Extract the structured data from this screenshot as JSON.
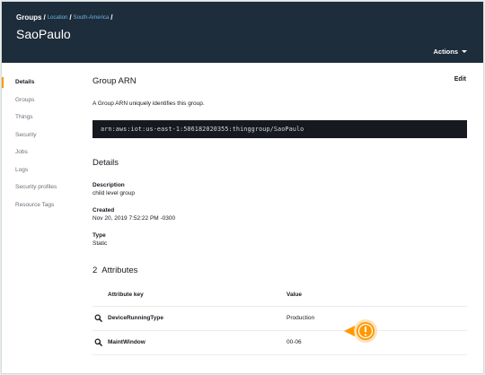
{
  "breadcrumb": {
    "root": "Groups",
    "sep": "/",
    "items": [
      "Location",
      "South-America"
    ]
  },
  "header": {
    "title": "SaoPaulo",
    "actions_label": "Actions"
  },
  "sidebar": {
    "items": [
      {
        "label": "Details",
        "active": true
      },
      {
        "label": "Groups"
      },
      {
        "label": "Things"
      },
      {
        "label": "Security"
      },
      {
        "label": "Jobs"
      },
      {
        "label": "Logs"
      },
      {
        "label": "Security profiles"
      },
      {
        "label": "Resource Tags"
      }
    ]
  },
  "arn": {
    "title": "Group ARN",
    "edit_label": "Edit",
    "description": "A Group ARN uniquely identifies this group.",
    "value": "arn:aws:iot:us-east-1:506182020355:thinggroup/SaoPaulo"
  },
  "details": {
    "title": "Details",
    "fields": [
      {
        "label": "Description",
        "value": "child level group"
      },
      {
        "label": "Created",
        "value": "Nov 20, 2019 7:52:22 PM -0300"
      },
      {
        "label": "Type",
        "value": "Static"
      }
    ]
  },
  "attributes": {
    "count": "2",
    "title": "Attributes",
    "columns": [
      "Attribute key",
      "Value"
    ],
    "rows": [
      {
        "key": "DeviceRunningType",
        "value": "Production"
      },
      {
        "key": "MaintWindow",
        "value": "00-06"
      }
    ]
  },
  "colors": {
    "header_bg": "#1e2d3b",
    "accent": "#ff9900",
    "link": "#6fb3e0",
    "code_bg": "#16191f"
  },
  "icons": {
    "row_icon": "search-icon",
    "callout_icon": "exclamation-icon",
    "actions_caret": "caret-down-icon"
  }
}
